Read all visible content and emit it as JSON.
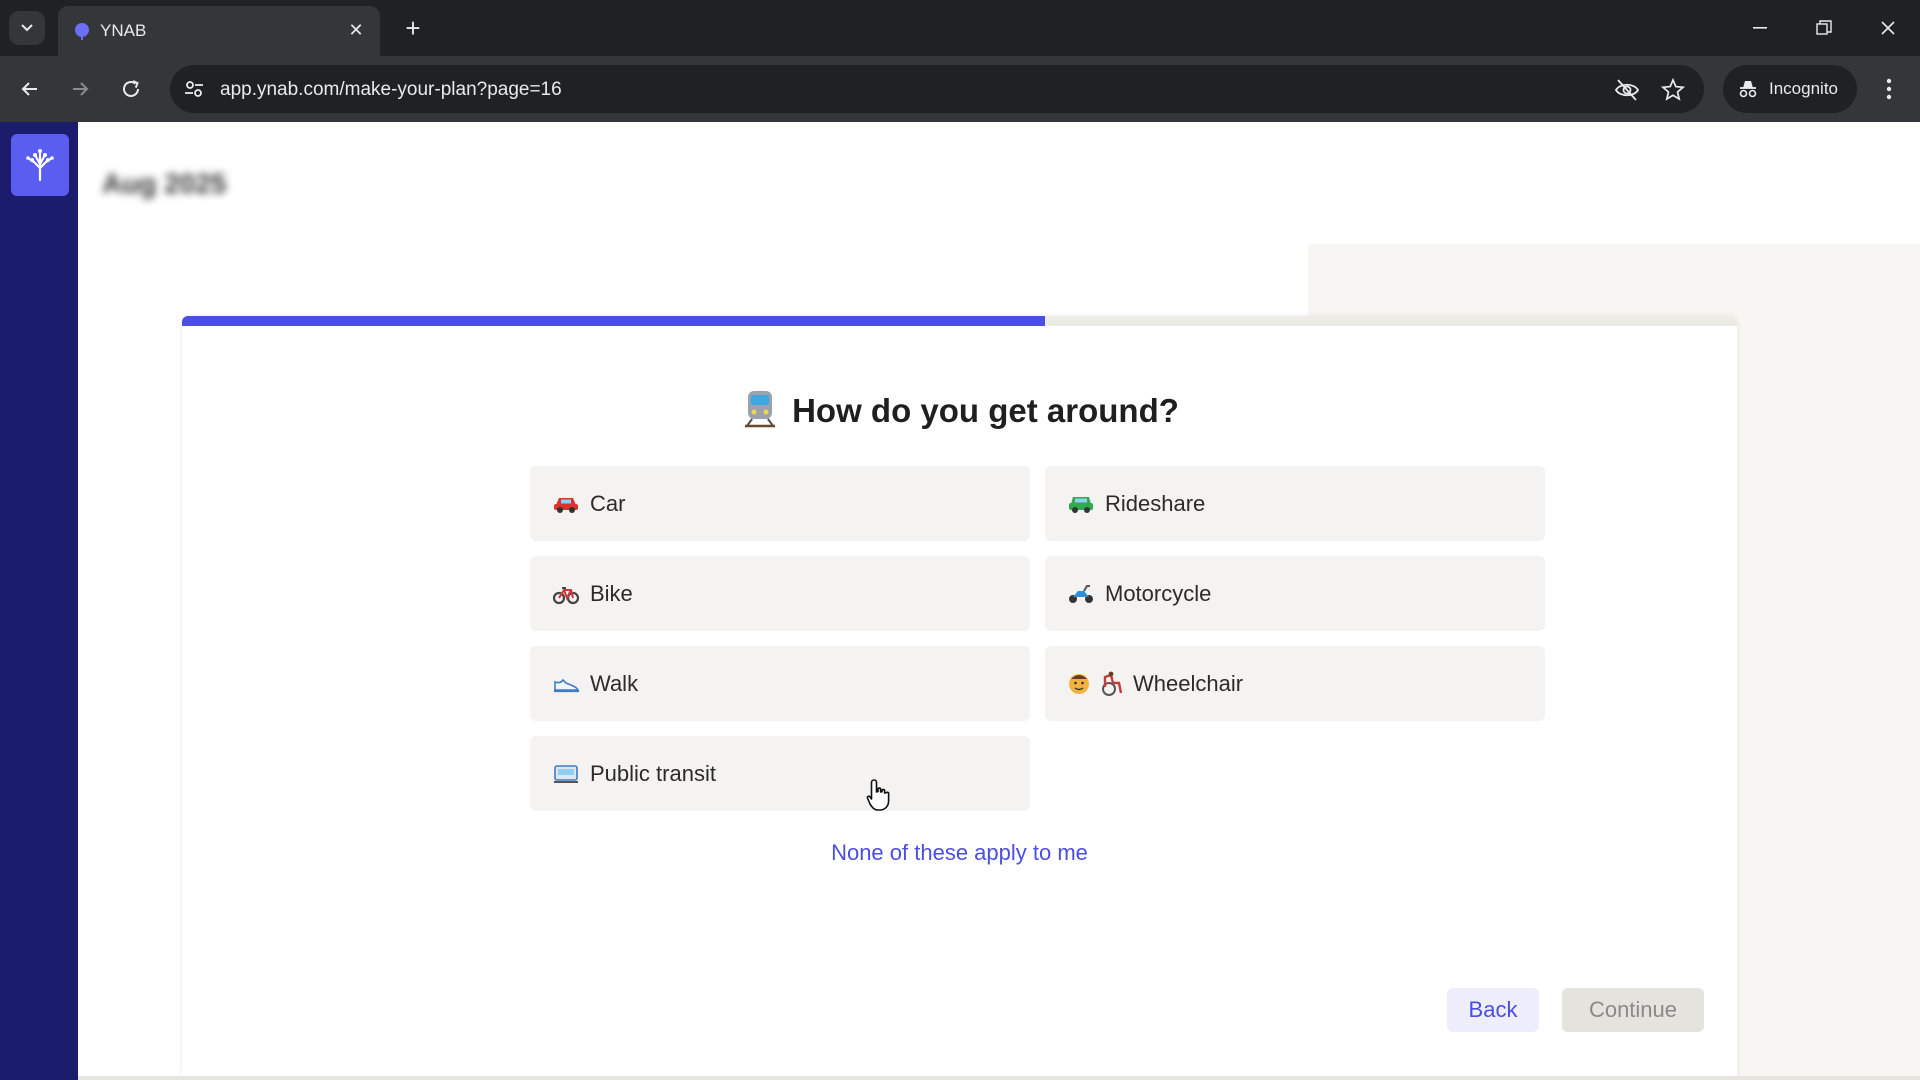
{
  "browser": {
    "tab_title": "YNAB",
    "url": "app.ynab.com/make-your-plan?page=16",
    "incognito_label": "Incognito"
  },
  "app": {
    "month_label": "Aug 2025",
    "progress_fraction": 0.555
  },
  "question": {
    "title": "How do you get around?",
    "title_icon": "train-emoji"
  },
  "options": [
    {
      "label": "Car",
      "icon": "car-emoji"
    },
    {
      "label": "Rideshare",
      "icon": "rideshare-car-emoji"
    },
    {
      "label": "Bike",
      "icon": "bicycle-emoji"
    },
    {
      "label": "Motorcycle",
      "icon": "motor-scooter-emoji"
    },
    {
      "label": "Walk",
      "icon": "shoe-emoji"
    },
    {
      "label": "Wheelchair",
      "icon": "wheelchair-emoji"
    },
    {
      "label": "Public transit",
      "icon": "tram-emoji"
    }
  ],
  "none_link": "None of these apply to me",
  "buttons": {
    "back": "Back",
    "continue": "Continue"
  },
  "colors": {
    "accent": "#4b4ee0",
    "sidebar": "#1c1c6c",
    "logo_tile": "#5a5ef0"
  }
}
